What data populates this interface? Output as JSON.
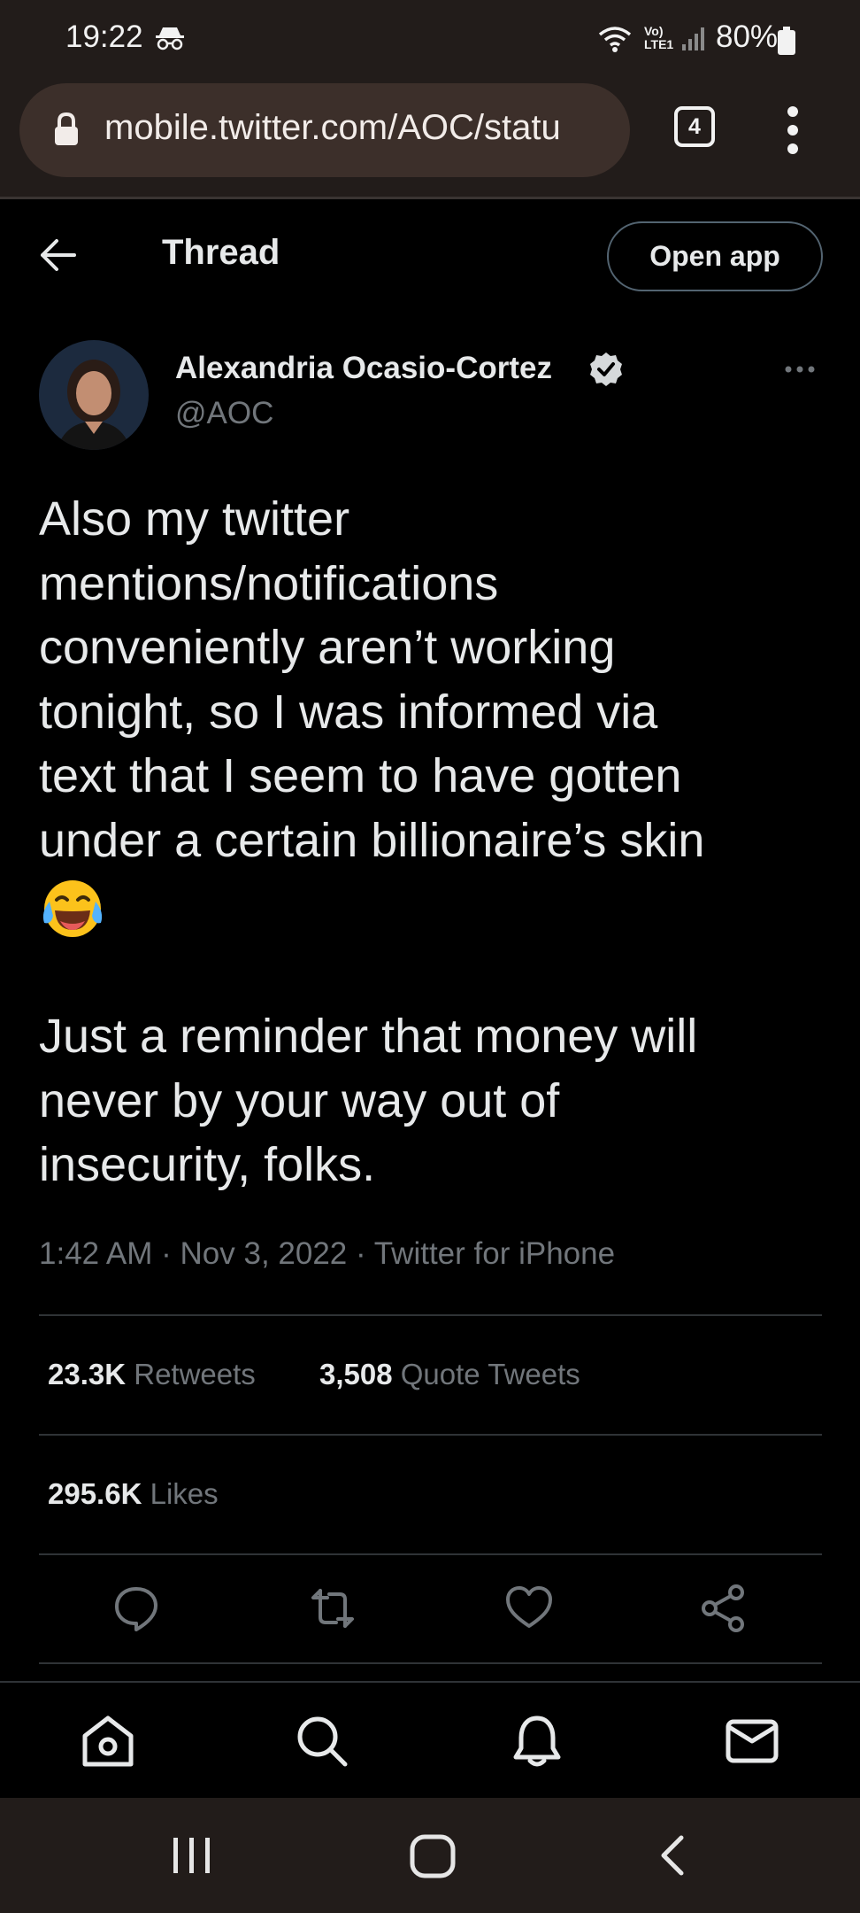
{
  "status_bar": {
    "time": "19:22",
    "network": "Vo) LTE1",
    "battery": "80%"
  },
  "browser": {
    "url": "mobile.twitter.com/AOC/statu",
    "tab_count": "4"
  },
  "header": {
    "title": "Thread",
    "open_app_label": "Open app"
  },
  "tweet": {
    "author_name": "Alexandria Ocasio-Cortez",
    "author_handle": "@AOC",
    "paragraph_1": "Also my twitter\nmentions/notifications\nconveniently aren’t working\ntonight, so I was informed via\ntext that I seem to have gotten\nunder a certain billionaire’s skin",
    "emoji": "face-with-tears-of-joy",
    "paragraph_2": "Just a reminder that money will\nnever by your way out of\ninsecurity, folks.",
    "timestamp": "1:42 AM · Nov 3, 2022 · Twitter for iPhone",
    "retweets_count": "23.3K",
    "retweets_label": "Retweets",
    "quotes_count": "3,508",
    "quotes_label": "Quote Tweets",
    "likes_count": "295.6K",
    "likes_label": "Likes"
  },
  "colors": {
    "background": "#000000",
    "chrome": "#221c1a",
    "secondary_text": "#71767b",
    "primary_text": "#e7e9ea"
  }
}
